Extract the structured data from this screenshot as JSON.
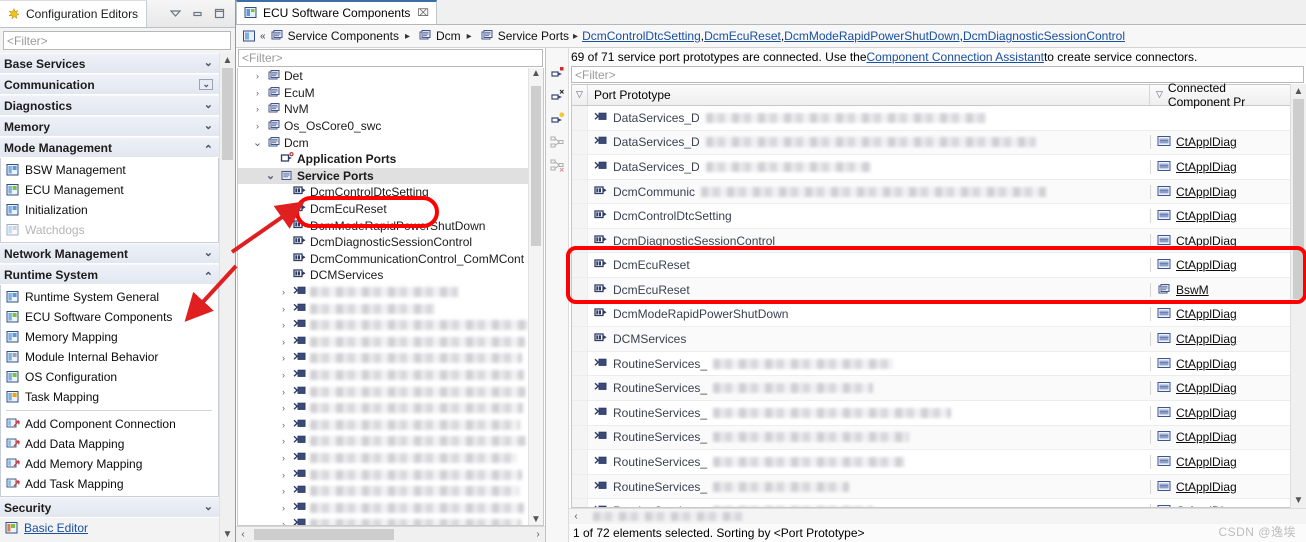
{
  "left_panel": {
    "tab_title": "Configuration Editors",
    "window_buttons": [
      "minimize-view-menu",
      "minimize",
      "maximize"
    ],
    "filter_placeholder": "<Filter>",
    "groups": [
      {
        "label": "Base Services",
        "expanded": false,
        "boxed": false,
        "items": []
      },
      {
        "label": "Communication",
        "expanded": false,
        "boxed": true,
        "items": []
      },
      {
        "label": "Diagnostics",
        "expanded": false,
        "boxed": false,
        "items": []
      },
      {
        "label": "Memory",
        "expanded": false,
        "boxed": false,
        "items": []
      },
      {
        "label": "Mode Management",
        "expanded": true,
        "boxed": false,
        "items": [
          {
            "label": "BSW Management",
            "icon": "editor-icon",
            "disabled": false
          },
          {
            "label": "ECU Management",
            "icon": "editor-icon",
            "disabled": false
          },
          {
            "label": "Initialization",
            "icon": "editor-icon",
            "disabled": false
          },
          {
            "label": "Watchdogs",
            "icon": "editor-icon",
            "disabled": true
          }
        ]
      },
      {
        "label": "Network Management",
        "expanded": false,
        "boxed": false,
        "items": []
      },
      {
        "label": "Runtime System",
        "expanded": true,
        "boxed": false,
        "items": [
          {
            "label": "Runtime System General",
            "icon": "editor-icon",
            "disabled": false
          },
          {
            "label": "ECU Software Components",
            "icon": "editor-icon",
            "disabled": false
          },
          {
            "label": "Memory Mapping",
            "icon": "editor-icon",
            "disabled": false
          },
          {
            "label": "Module Internal Behavior",
            "icon": "editor-icon",
            "disabled": false
          },
          {
            "label": "OS Configuration",
            "icon": "editor-icon",
            "disabled": false
          },
          {
            "label": "Task Mapping",
            "icon": "editor-icon",
            "disabled": false
          },
          {
            "separator": true
          },
          {
            "label": "Add Component Connection",
            "icon": "action-icon",
            "disabled": false
          },
          {
            "label": "Add Data Mapping",
            "icon": "action-icon",
            "disabled": false
          },
          {
            "label": "Add Memory Mapping",
            "icon": "action-icon",
            "disabled": false
          },
          {
            "label": "Add Task Mapping",
            "icon": "action-icon",
            "disabled": false
          }
        ]
      },
      {
        "label": "Security",
        "expanded": false,
        "boxed": false,
        "items": []
      }
    ],
    "security_link": "Basic Editor"
  },
  "editor": {
    "tab_label": "ECU Software Components",
    "tab_close": "⌧",
    "breadcrumb": {
      "home_icon": "perspective-icon",
      "back_icon": "«",
      "segments": [
        {
          "label": "Service Components",
          "type": "text"
        },
        {
          "label": "Dcm",
          "type": "text"
        },
        {
          "label": "Service Ports",
          "type": "text"
        }
      ],
      "links": [
        "DcmControlDtcSetting",
        "DcmEcuReset",
        "DcmModeRapidPowerShutDown",
        "DcmDiagnosticSessionControl"
      ],
      "separator": "▸",
      "link_separator": ", "
    }
  },
  "tree": {
    "filter_placeholder": "<Filter>",
    "nodes": [
      {
        "label": "Det",
        "indent": 1,
        "twisty": "›",
        "icon": "component-icon",
        "state": "normal"
      },
      {
        "label": "EcuM",
        "indent": 1,
        "twisty": "›",
        "icon": "component-icon",
        "state": "normal"
      },
      {
        "label": "NvM",
        "indent": 1,
        "twisty": "›",
        "icon": "component-icon",
        "state": "normal"
      },
      {
        "label": "Os_OsCore0_swc",
        "indent": 1,
        "twisty": "›",
        "icon": "component-icon",
        "state": "normal"
      },
      {
        "label": "Dcm",
        "indent": 1,
        "twisty": "⌄",
        "icon": "component-icon",
        "state": "normal"
      },
      {
        "label": "Application Ports",
        "indent": 2,
        "twisty": "",
        "icon": "app-ports-icon",
        "state": "bold"
      },
      {
        "label": "Service Ports",
        "indent": 2,
        "twisty": "⌄",
        "icon": "service-ports-icon",
        "state": "selected"
      },
      {
        "label": "DcmControlDtcSetting",
        "indent": 3,
        "twisty": "",
        "icon": "port-icon",
        "state": "normal"
      },
      {
        "label": "DcmEcuReset",
        "indent": 3,
        "twisty": "",
        "icon": "port-icon",
        "state": "normal"
      },
      {
        "label": "DcmModeRapidPowerShutDown",
        "indent": 3,
        "twisty": "",
        "icon": "port-icon",
        "state": "normal"
      },
      {
        "label": "DcmDiagnosticSessionControl",
        "indent": 3,
        "twisty": "",
        "icon": "port-icon",
        "state": "normal"
      },
      {
        "label": "DcmCommunicationControl_ComMCont",
        "indent": 3,
        "twisty": "",
        "icon": "port-icon",
        "state": "normal"
      },
      {
        "label": "DCMServices",
        "indent": 3,
        "twisty": "",
        "icon": "port-icon",
        "state": "normal"
      },
      {
        "label": "",
        "indent": 3,
        "twisty": "›",
        "icon": "port-icon",
        "state": "blurred",
        "blur_width": 148
      },
      {
        "label": "",
        "indent": 3,
        "twisty": "›",
        "icon": "port-icon",
        "state": "blurred",
        "blur_width": 125
      },
      {
        "label": "",
        "indent": 3,
        "twisty": "›",
        "icon": "port-icon",
        "state": "blurred",
        "blur_width": 218
      },
      {
        "label": "",
        "indent": 3,
        "twisty": "›",
        "icon": "port-icon",
        "state": "blurred",
        "blur_width": 215
      },
      {
        "label": "",
        "indent": 3,
        "twisty": "›",
        "icon": "port-icon",
        "state": "blurred",
        "blur_width": 212
      },
      {
        "label": "",
        "indent": 3,
        "twisty": "›",
        "icon": "port-icon",
        "state": "blurred",
        "blur_width": 214
      },
      {
        "label": "",
        "indent": 3,
        "twisty": "›",
        "icon": "port-icon",
        "state": "blurred",
        "blur_width": 216
      },
      {
        "label": "",
        "indent": 3,
        "twisty": "›",
        "icon": "port-icon",
        "state": "blurred",
        "blur_width": 213
      },
      {
        "label": "",
        "indent": 3,
        "twisty": "›",
        "icon": "port-icon",
        "state": "blurred",
        "blur_width": 210
      },
      {
        "label": "",
        "indent": 3,
        "twisty": "›",
        "icon": "port-icon",
        "state": "blurred",
        "blur_width": 216
      },
      {
        "label": "",
        "indent": 3,
        "twisty": "›",
        "icon": "port-icon",
        "state": "blurred",
        "blur_width": 207
      },
      {
        "label": "",
        "indent": 3,
        "twisty": "›",
        "icon": "port-icon",
        "state": "blurred",
        "blur_width": 212
      },
      {
        "label": "",
        "indent": 3,
        "twisty": "›",
        "icon": "port-icon",
        "state": "blurred",
        "blur_width": 209
      },
      {
        "label": "",
        "indent": 3,
        "twisty": "›",
        "icon": "port-icon",
        "state": "blurred",
        "blur_width": 214
      },
      {
        "label": "",
        "indent": 3,
        "twisty": "›",
        "icon": "port-icon",
        "state": "blurred",
        "blur_width": 211
      }
    ]
  },
  "info": {
    "prefix": "69 of 71 service port prototypes are connected. Use the ",
    "link": "Component Connection Assistant",
    "suffix": " to create service connectors."
  },
  "table": {
    "filter_placeholder": "<Filter>",
    "columns": [
      "Port Prototype",
      "Connected Component Pr"
    ],
    "rows": [
      {
        "port": "DataServices_D",
        "blur_width": 280,
        "icon": "require-port-icon",
        "connected": "",
        "connected_icon": ""
      },
      {
        "port": "DataServices_D",
        "blur_width": 330,
        "icon": "require-port-icon",
        "connected": "CtApplDiag",
        "connected_icon": "component-proto-icon"
      },
      {
        "port": "DataServices_D",
        "blur_width": 165,
        "icon": "require-port-icon",
        "connected": "CtApplDiag",
        "connected_icon": "component-proto-icon"
      },
      {
        "port": "DcmCommunic",
        "blur_width": 345,
        "icon": "provide-port-icon",
        "connected": "CtApplDiag",
        "connected_icon": "component-proto-icon"
      },
      {
        "port": "DcmControlDtcSetting",
        "blur_width": 0,
        "icon": "provide-port-icon",
        "connected": "CtApplDiag",
        "connected_icon": "component-proto-icon"
      },
      {
        "port": "DcmDiagnosticSessionControl",
        "blur_width": 0,
        "icon": "provide-port-icon",
        "connected": "CtApplDiag",
        "connected_icon": "component-proto-icon"
      },
      {
        "port": "DcmEcuReset",
        "blur_width": 0,
        "icon": "provide-port-icon",
        "connected": "CtApplDiag",
        "connected_icon": "component-proto-icon",
        "highlighted": true
      },
      {
        "port": "DcmEcuReset",
        "blur_width": 0,
        "icon": "provide-port-icon",
        "connected": "BswM",
        "connected_icon": "component-icon",
        "highlighted": true
      },
      {
        "port": "DcmModeRapidPowerShutDown",
        "blur_width": 0,
        "icon": "provide-port-icon",
        "connected": "CtApplDiag",
        "connected_icon": "component-proto-icon"
      },
      {
        "port": "DCMServices",
        "blur_width": 0,
        "icon": "provide-port-icon",
        "connected": "CtApplDiag",
        "connected_icon": "component-proto-icon"
      },
      {
        "port": "RoutineServices_",
        "blur_width": 180,
        "icon": "require-port-icon",
        "connected": "CtApplDiag",
        "connected_icon": "component-proto-icon"
      },
      {
        "port": "RoutineServices_",
        "blur_width": 160,
        "icon": "require-port-icon",
        "connected": "CtApplDiag",
        "connected_icon": "component-proto-icon"
      },
      {
        "port": "RoutineServices_",
        "blur_width": 238,
        "icon": "require-port-icon",
        "connected": "CtApplDiag",
        "connected_icon": "component-proto-icon"
      },
      {
        "port": "RoutineServices_",
        "blur_width": 196,
        "icon": "require-port-icon",
        "connected": "CtApplDiag",
        "connected_icon": "component-proto-icon"
      },
      {
        "port": "RoutineServices_",
        "blur_width": 192,
        "icon": "require-port-icon",
        "connected": "CtApplDiag",
        "connected_icon": "component-proto-icon"
      },
      {
        "port": "RoutineServices_",
        "blur_width": 136,
        "icon": "require-port-icon",
        "connected": "CtApplDiag",
        "connected_icon": "component-proto-icon"
      },
      {
        "port": "RoutineServices_",
        "blur_width": 160,
        "icon": "require-port-icon",
        "connected": "CtApplDiag",
        "connected_icon": "component-proto-icon"
      }
    ],
    "status": "1 of 72 elements selected. Sorting by <Port Prototype>"
  },
  "watermark": "CSDN @逸埃",
  "annotations": {
    "highlight_color": "#ff0000",
    "shapes": [
      "tree-dcmecureset-ellipse",
      "tree-arrow",
      "sidebar-arrow",
      "table-rows-rect"
    ]
  }
}
